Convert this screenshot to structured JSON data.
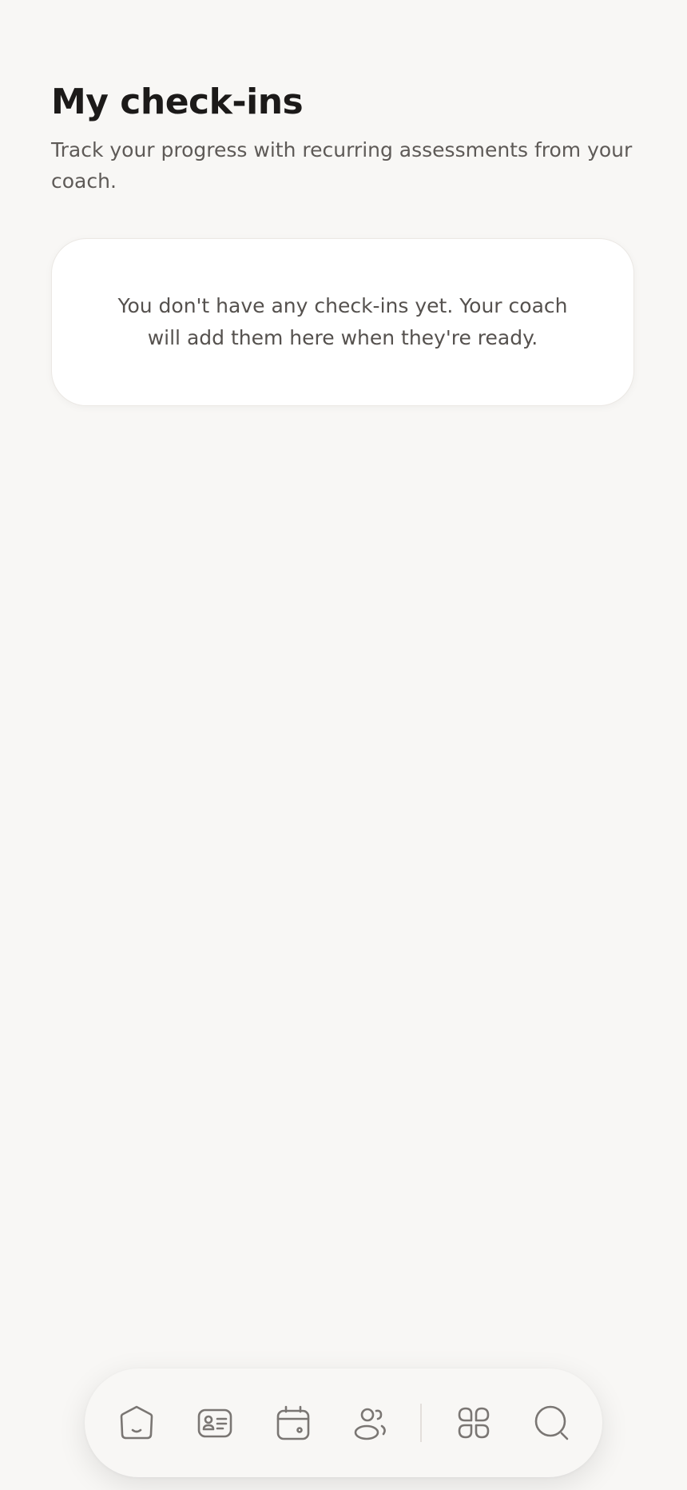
{
  "header": {
    "title": "My check-ins",
    "subtitle": "Track your progress with recurring assessments from your coach."
  },
  "empty_state": {
    "message": "You don't have any check-ins yet. Your coach will add them here when they're ready."
  },
  "bottom_nav": {
    "items": [
      {
        "icon": "home-smile-icon"
      },
      {
        "icon": "profile-card-icon"
      },
      {
        "icon": "calendar-icon"
      },
      {
        "icon": "people-icon"
      },
      {
        "icon": "apps-grid-icon"
      },
      {
        "icon": "search-icon"
      }
    ]
  },
  "colors": {
    "background": "#f8f7f5",
    "card": "#ffffff",
    "title": "#1c1a19",
    "muted_text": "#5e5a57",
    "icon": "#7a7673"
  }
}
